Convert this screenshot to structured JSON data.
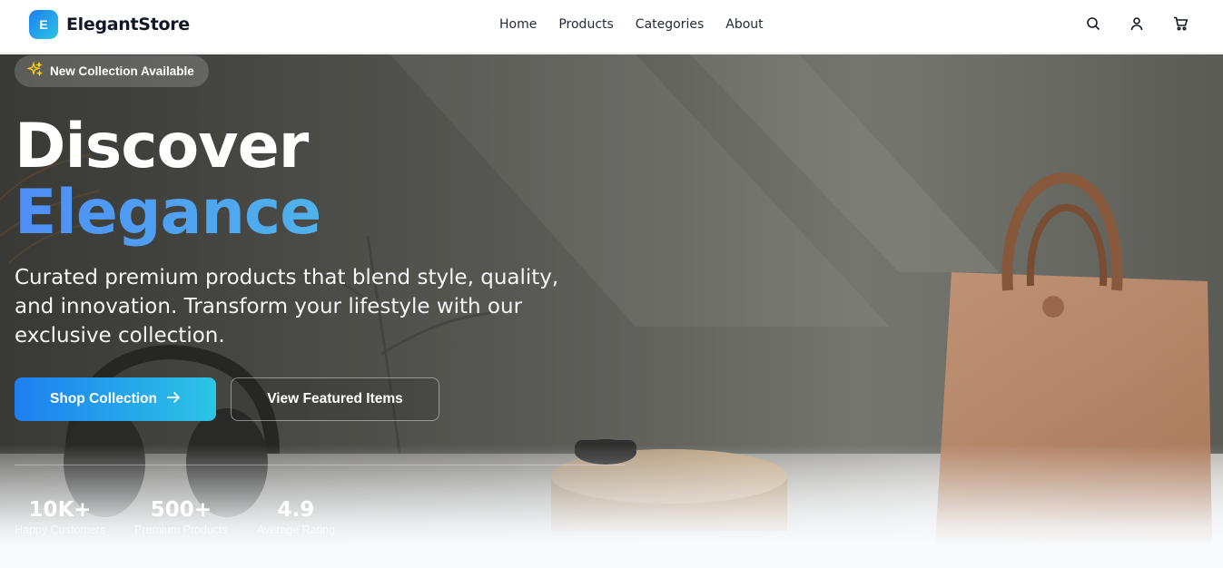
{
  "brand": {
    "logo_letter": "E",
    "name": "ElegantStore",
    "accent_start": "#1d7ff0",
    "accent_end": "#2cc5e4"
  },
  "nav": {
    "items": [
      {
        "label": "Home"
      },
      {
        "label": "Products"
      },
      {
        "label": "Categories"
      },
      {
        "label": "About"
      }
    ]
  },
  "header_icons": [
    "search-icon",
    "user-icon",
    "cart-icon"
  ],
  "hero": {
    "badge": {
      "icon": "sparkles-icon",
      "text": "New Collection Available"
    },
    "title_line1": "Discover",
    "title_line2": "Elegance",
    "subtitle": "Curated premium products that blend style, quality, and innovation. Transform your lifestyle with our exclusive collection.",
    "primary_button": {
      "label": "Shop Collection",
      "icon": "arrow-right-icon"
    },
    "secondary_button": {
      "label": "View Featured Items"
    },
    "stats": [
      {
        "value": "10K+",
        "label": "Happy Customers"
      },
      {
        "value": "500+",
        "label": "Premium Products"
      },
      {
        "value": "4.9",
        "label": "Average Rating"
      }
    ]
  }
}
